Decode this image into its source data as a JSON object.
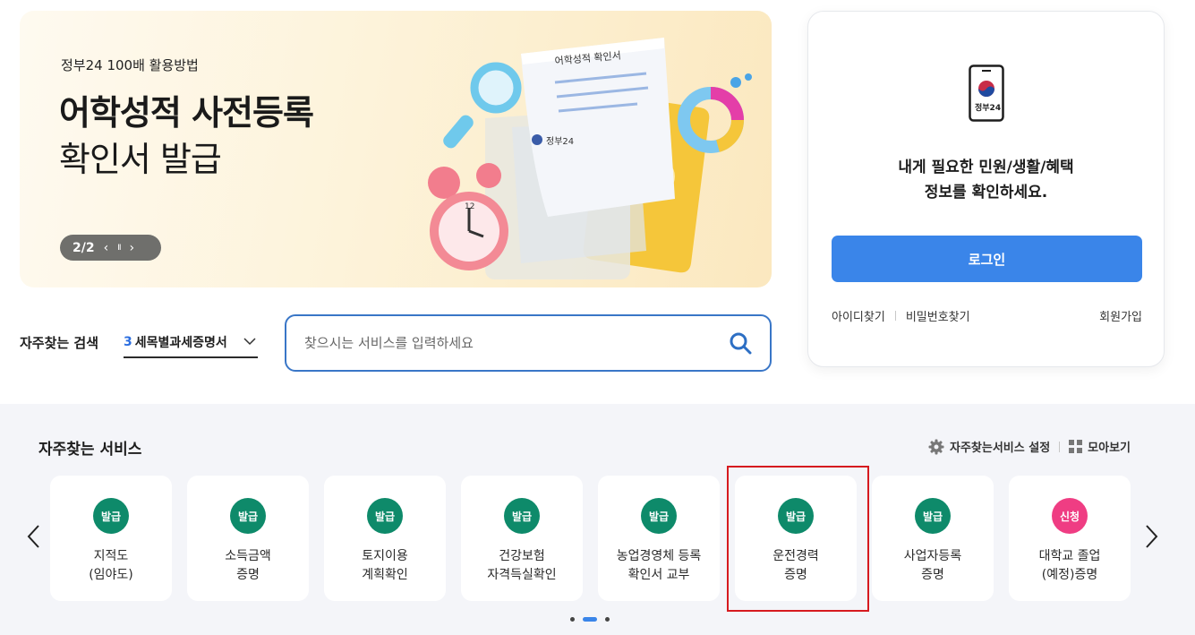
{
  "banner": {
    "subtitle": "정부24 100배 활용방법",
    "title_line1": "어학성적 사전등록",
    "title_line2": "확인서 발급",
    "pager_text": "2/2",
    "prev_symbol": "‹",
    "pause_symbol": "II",
    "next_symbol": "›",
    "doc_title": "어학성적 확인서",
    "doc_brand": "정부24"
  },
  "login": {
    "app_brand": "정부24",
    "message_line1": "내게 필요한 민원/생활/혜택",
    "message_line2": "정보를 확인하세요.",
    "login_button": "로그인",
    "find_id": "아이디찾기",
    "find_password": "비밀번호찾기",
    "signup": "회원가입"
  },
  "frequent_search": {
    "label": "자주찾는 검색",
    "selected_rank": "3",
    "selected_text": "세목별과세증명서"
  },
  "search": {
    "placeholder": "찾으시는 서비스를 입력하세요"
  },
  "services": {
    "title": "자주찾는 서비스",
    "settings_label": "자주찾는서비스 설정",
    "view_all_label": "모아보기",
    "items": [
      {
        "badge": "발급",
        "label": "지적도\n(임야도)",
        "badge_color": "#0e8a6a"
      },
      {
        "badge": "발급",
        "label": "소득금액\n증명",
        "badge_color": "#0e8a6a"
      },
      {
        "badge": "발급",
        "label": "토지이용\n계획확인",
        "badge_color": "#0e8a6a"
      },
      {
        "badge": "발급",
        "label": "건강보험\n자격득실확인",
        "badge_color": "#0e8a6a"
      },
      {
        "badge": "발급",
        "label": "농업경영체 등록\n확인서 교부",
        "badge_color": "#0e8a6a"
      },
      {
        "badge": "발급",
        "label": "운전경력\n증명",
        "badge_color": "#0e8a6a"
      },
      {
        "badge": "발급",
        "label": "사업자등록\n증명",
        "badge_color": "#0e8a6a"
      },
      {
        "badge": "신청",
        "label": "대학교 졸업\n(예정)증명",
        "badge_color": "#ef3d83"
      }
    ],
    "carousel_active_page": 2,
    "carousel_pages": 3
  },
  "colors": {
    "primary": "#3a85e9",
    "issue_badge": "#0e8a6a",
    "apply_badge": "#ef3d83",
    "highlight_border": "#d61a1f"
  }
}
